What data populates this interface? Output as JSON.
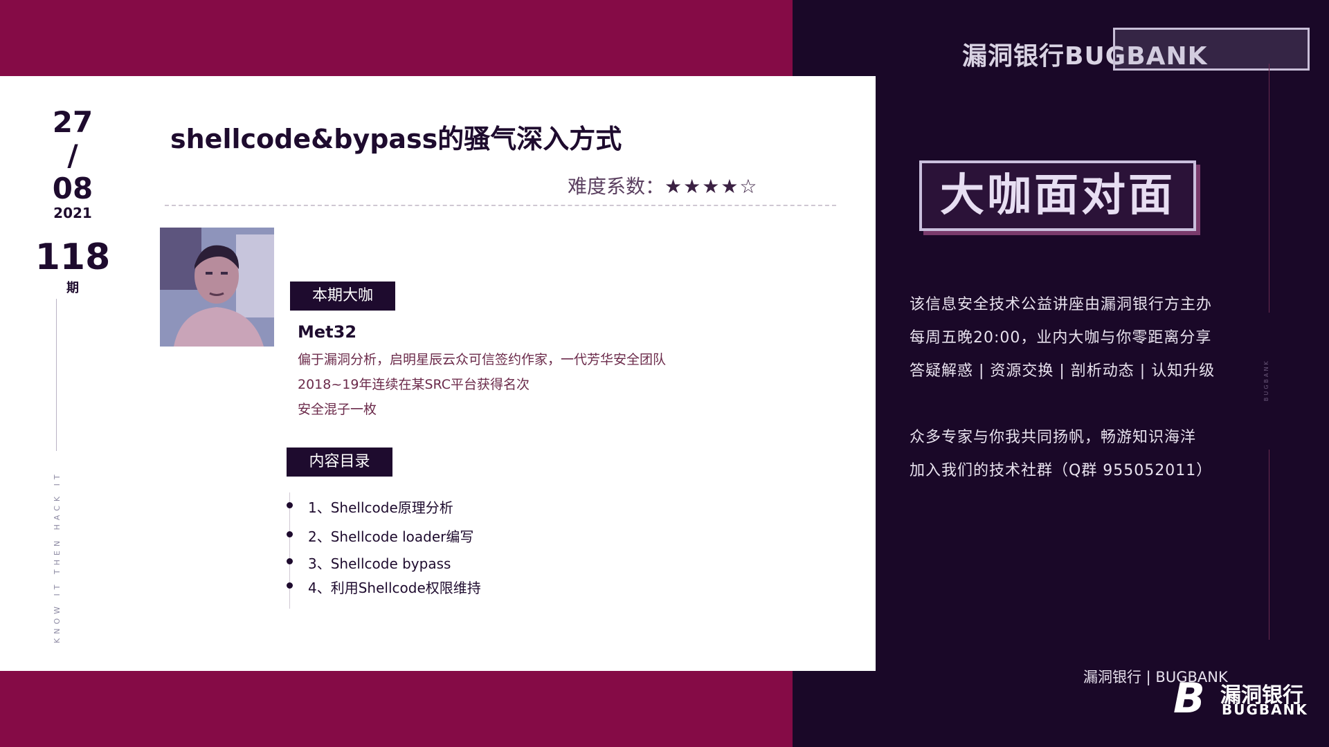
{
  "date": {
    "day": "27",
    "slash": "/",
    "month": "08",
    "year": "2021"
  },
  "issue": {
    "number": "118",
    "label": "期"
  },
  "slogan": "KNOW IT THEN HACK IT",
  "title": "shellcode&bypass的骚气深入方式",
  "difficulty": {
    "label": "难度系数：",
    "rating": 4,
    "max": 5,
    "stars": "★★★★☆"
  },
  "guest": {
    "tag": "本期大咖",
    "name": "Met32",
    "bio": [
      "偏于漏洞分析，启明星辰云众可信签约作家，一代芳华安全团队",
      "2018~19年连续在某SRC平台获得名次",
      "安全混子一枚"
    ]
  },
  "toc": {
    "tag": "内容目录",
    "items": [
      "1、Shellcode原理分析",
      "2、Shellcode loader编写",
      "3、Shellcode bypass",
      "4、利用Shellcode权限维持"
    ]
  },
  "brand": {
    "top": "漏洞银行BUGBANK",
    "overlay": "大咖面对面",
    "vertical": "BUGBANK"
  },
  "logo_art": "大咖面对面",
  "info_lines": [
    "该信息安全技术公益讲座由漏洞银行方主办",
    "每周五晚20:00，业内大咖与你零距离分享",
    "答疑解惑 | 资源交换 | 剖析动态 | 认知升级",
    "众多专家与你我共同扬帆，畅游知识海洋",
    "加入我们的技术社群（Q群 955052011）"
  ],
  "footer": {
    "text": "漏洞银行 | BUGBANK",
    "logo_cn": "漏洞银行",
    "logo_en": "BUGBANK",
    "logo_mark": "B"
  },
  "colors": {
    "magenta": "#850b46",
    "dark_purple": "#1a0828",
    "card": "#ffffff",
    "accent_text": "#6b2a4a"
  }
}
